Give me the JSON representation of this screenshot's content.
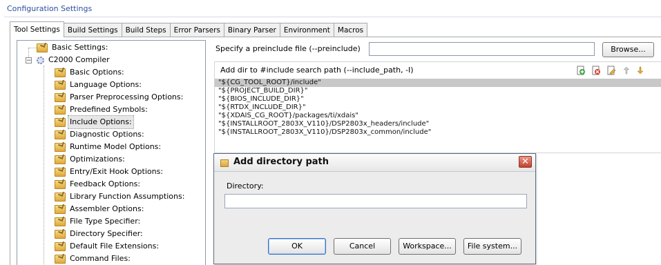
{
  "window": {
    "title": "Configuration Settings"
  },
  "tabs": [
    {
      "label": "Tool Settings",
      "active": true
    },
    {
      "label": "Build Settings",
      "active": false
    },
    {
      "label": "Build Steps",
      "active": false
    },
    {
      "label": "Error Parsers",
      "active": false
    },
    {
      "label": "Binary Parser",
      "active": false
    },
    {
      "label": "Environment",
      "active": false
    },
    {
      "label": "Macros",
      "active": false
    }
  ],
  "tree": {
    "items": [
      {
        "label": "Basic Settings:",
        "icon": "folder-settings-icon"
      },
      {
        "label": "C2000 Compiler",
        "icon": "gear-icon",
        "expanded": true
      },
      {
        "label": "Basic Options:",
        "icon": "folder-settings-icon"
      },
      {
        "label": "Language Options:",
        "icon": "folder-settings-icon"
      },
      {
        "label": "Parser Preprocessing Options:",
        "icon": "folder-settings-icon"
      },
      {
        "label": "Predefined Symbols:",
        "icon": "folder-settings-icon"
      },
      {
        "label": "Include Options:",
        "icon": "folder-settings-icon",
        "selected": true
      },
      {
        "label": "Diagnostic Options:",
        "icon": "folder-settings-icon"
      },
      {
        "label": "Runtime Model Options:",
        "icon": "folder-settings-icon"
      },
      {
        "label": "Optimizations:",
        "icon": "folder-settings-icon"
      },
      {
        "label": "Entry/Exit Hook Options:",
        "icon": "folder-settings-icon"
      },
      {
        "label": "Feedback Options:",
        "icon": "folder-settings-icon"
      },
      {
        "label": "Library Function Assumptions:",
        "icon": "folder-settings-icon"
      },
      {
        "label": "Assembler Options:",
        "icon": "folder-settings-icon"
      },
      {
        "label": "File Type Specifier:",
        "icon": "folder-settings-icon"
      },
      {
        "label": "Directory Specifier:",
        "icon": "folder-settings-icon"
      },
      {
        "label": "Default File Extensions:",
        "icon": "folder-settings-icon"
      },
      {
        "label": "Command Files:",
        "icon": "folder-settings-icon"
      }
    ]
  },
  "preinclude": {
    "label": "Specify a preinclude file (--preinclude)",
    "value": "",
    "browse_label": "Browse..."
  },
  "include_path": {
    "label": "Add dir to #include search path (--include_path, -I)",
    "toolbar_icons": [
      "add-icon",
      "delete-icon",
      "edit-icon",
      "move-up-icon",
      "move-down-icon"
    ],
    "entries": [
      "\"${CG_TOOL_ROOT}/include\"",
      "\"${PROJECT_BUILD_DIR}\"",
      "\"${BIOS_INCLUDE_DIR}\"",
      "\"${RTDX_INCLUDE_DIR}\"",
      "\"${XDAIS_CG_ROOT}/packages/ti/xdais\"",
      "\"${INSTALLROOT_2803X_V110}/DSP2803x_headers/include\"",
      "\"${INSTALLROOT_2803X_V110}/DSP2803x_common/include\""
    ],
    "selected_index": 0
  },
  "dialog": {
    "title": "Add directory path",
    "close_glyph": "✕",
    "directory_label": "Directory:",
    "directory_value": "",
    "buttons": {
      "ok": "OK",
      "cancel": "Cancel",
      "workspace": "Workspace...",
      "file_system": "File system..."
    }
  }
}
